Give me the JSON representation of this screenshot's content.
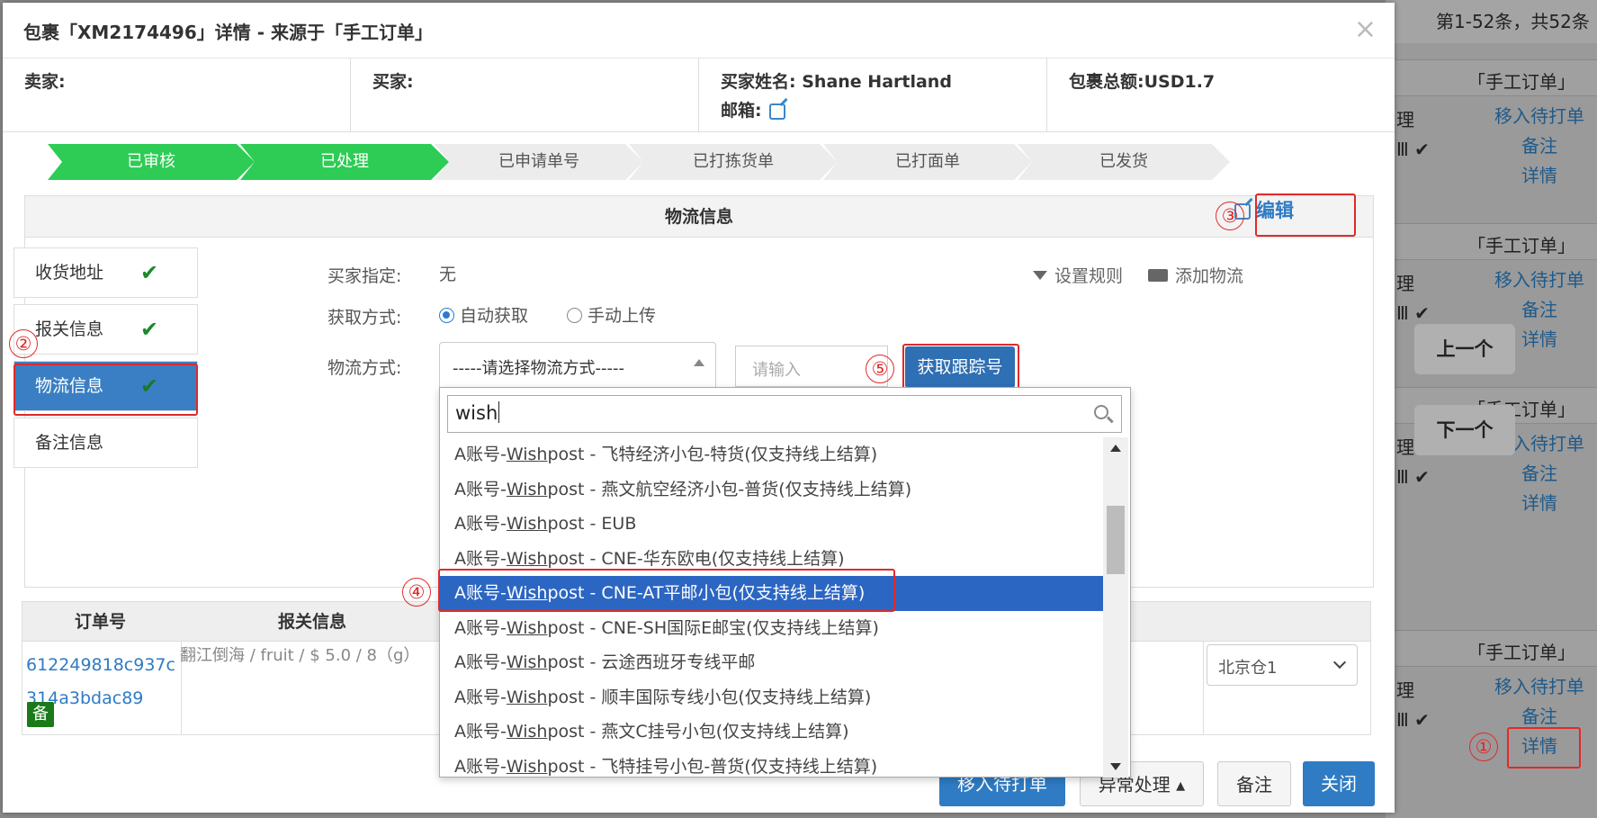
{
  "modal": {
    "title": "包裹「XM2174496」详情 - 来源于「手工订单」",
    "close": "×"
  },
  "info": {
    "seller_label": "卖家:",
    "buyer_label": "买家:",
    "buyer_name_label": "买家姓名:",
    "buyer_name_value": "Shane Hartland",
    "email_label": "邮箱:",
    "total_label": "包裹总额:",
    "total_value": "USD1.7"
  },
  "steps": [
    {
      "label": "已审核",
      "done": true
    },
    {
      "label": "已处理",
      "done": true
    },
    {
      "label": "已申请单号",
      "done": false
    },
    {
      "label": "已打拣货单",
      "done": false
    },
    {
      "label": "已打面单",
      "done": false
    },
    {
      "label": "已发货",
      "done": false
    }
  ],
  "panel": {
    "title": "物流信息",
    "edit_label": "编辑"
  },
  "side_menu": [
    {
      "label": "收货地址",
      "check": "✔"
    },
    {
      "label": "报关信息",
      "check": "✔"
    },
    {
      "label": "物流信息",
      "check": "✔"
    },
    {
      "label": "备注信息"
    }
  ],
  "form": {
    "buyer_specified_label": "买家指定:",
    "buyer_specified_value": "无",
    "fetch_mode_label": "获取方式:",
    "fetch_auto": "自动获取",
    "fetch_manual": "手动上传",
    "logistics_label": "物流方式:",
    "select_value": "-----请选择物流方式-----",
    "input_placeholder": "请输入",
    "get_tracking": "获取跟踪号",
    "set_rules": "设置规则",
    "add_logistics": "添加物流"
  },
  "dropdown": {
    "search_value": "wish",
    "items": [
      {
        "pre": "A账号-",
        "kw": "Wish",
        "post": "post - 飞特经济小包-特货(仅支持线上结算)"
      },
      {
        "pre": "A账号-",
        "kw": "Wish",
        "post": "post - 燕文航空经济小包-普货(仅支持线上结算)"
      },
      {
        "pre": "A账号-",
        "kw": "Wish",
        "post": "post - EUB"
      },
      {
        "pre": "A账号-",
        "kw": "Wish",
        "post": "post - CNE-华东欧电(仅支持线上结算)"
      },
      {
        "pre": "A账号-",
        "kw": "Wish",
        "post": "post - CNE-AT平邮小包(仅支持线上结算)",
        "selected": true
      },
      {
        "pre": "A账号-",
        "kw": "Wish",
        "post": "post - CNE-SH国际E邮宝(仅支持线上结算)"
      },
      {
        "pre": "A账号-",
        "kw": "Wish",
        "post": "post - 云途西班牙专线平邮"
      },
      {
        "pre": "A账号-",
        "kw": "Wish",
        "post": "post - 顺丰国际专线小包(仅支持线上结算)"
      },
      {
        "pre": "A账号-",
        "kw": "Wish",
        "post": "post - 燕文C挂号小包(仅支持线上结算)"
      },
      {
        "pre": "A账号-",
        "kw": "Wish",
        "post": "post - 飞特挂号小包-普货(仅支持线上结算)"
      }
    ]
  },
  "table": {
    "col_order": "订单号",
    "col_customs": "报关信息",
    "order_id": "612249818c937c314a3bdac89",
    "bei_badge": "备",
    "customs_text": "翻江倒海 / fruit / $ 5.0 / 8（g）",
    "warehouse": "北京仓1"
  },
  "footer": {
    "move_to_print": "移入待打单",
    "exception": "异常处理 ▴",
    "remark": "备注",
    "close": "关闭"
  },
  "background": {
    "pager": "第1-52条，共52条",
    "source_tag": "「手工订单」",
    "row_left_1": "理",
    "row_left_2": "Ⅲ ✔",
    "act_move": "移入待打单",
    "act_remark": "备注",
    "act_detail": "详情",
    "prev": "上一个",
    "next": "下一个"
  },
  "annotations": [
    "①",
    "②",
    "③",
    "④",
    "⑤"
  ],
  "colors": {
    "step_done": "#2ecc55",
    "step_todo": "#ececec",
    "primary": "#2f7bc4",
    "annotation_red": "#e02a2a"
  }
}
